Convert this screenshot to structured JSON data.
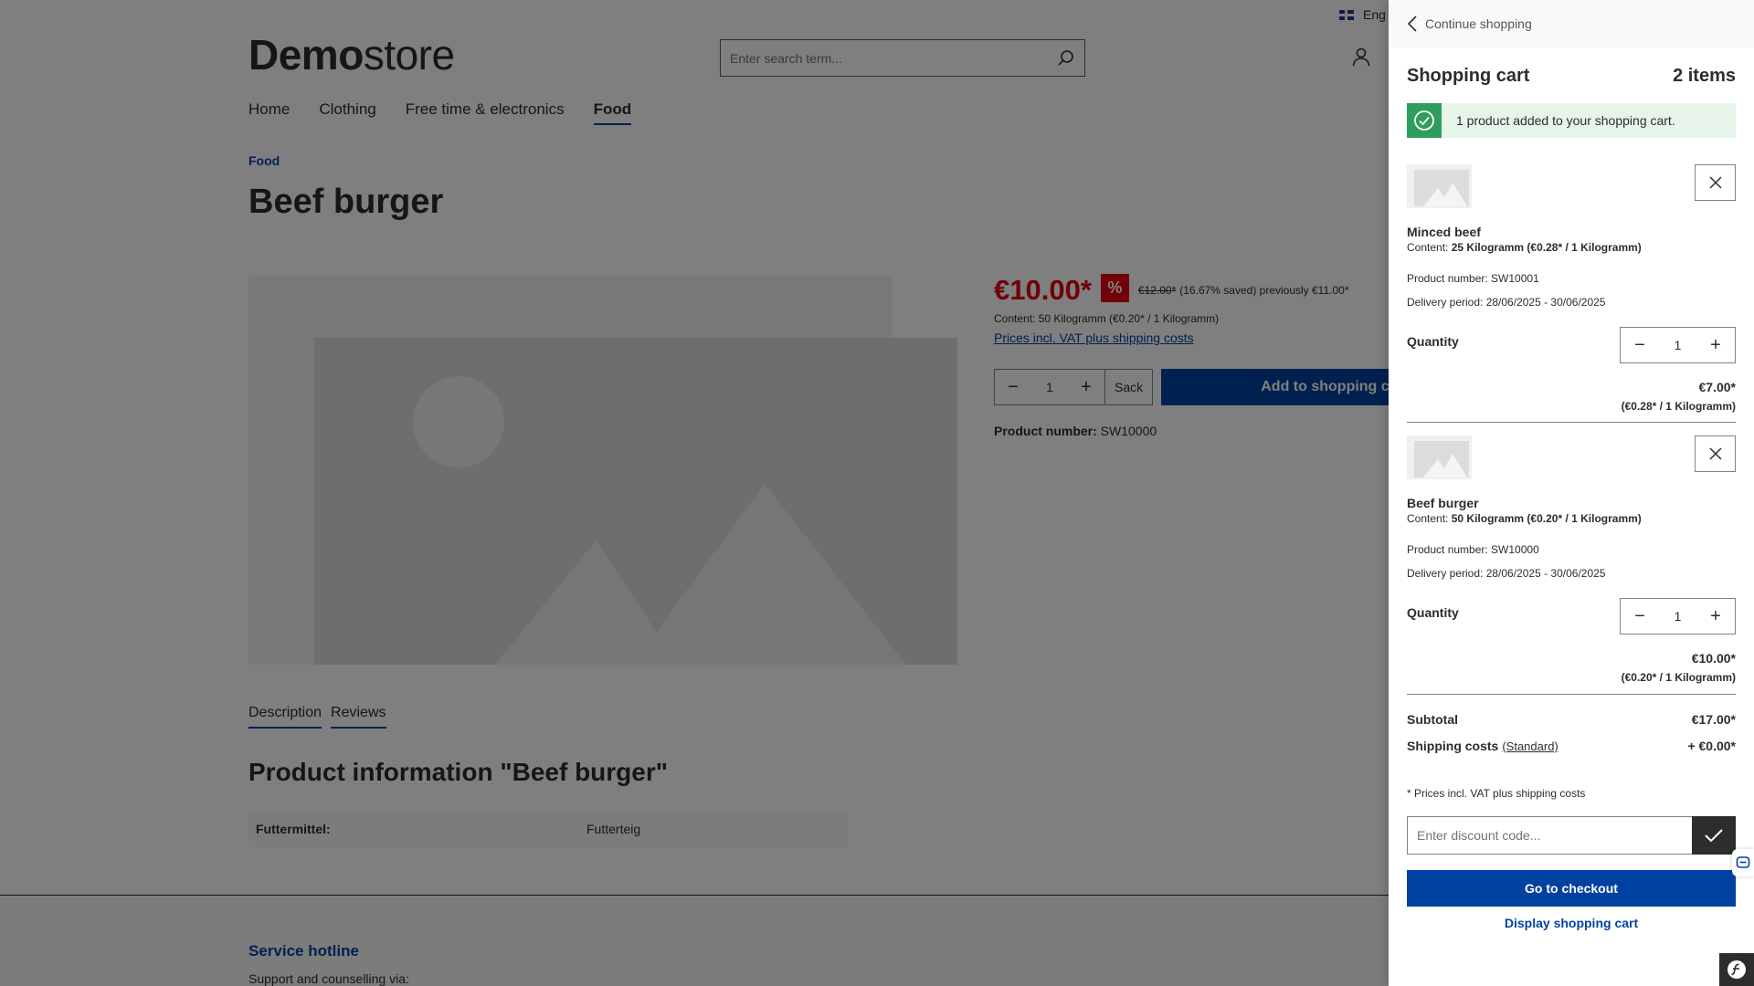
{
  "header": {
    "language": "Eng",
    "logo_bold": "Demo",
    "logo_light": "store",
    "search_placeholder": "Enter search term..."
  },
  "nav": {
    "items": [
      "Home",
      "Clothing",
      "Free time & electronics",
      "Food"
    ],
    "active": "Food"
  },
  "product": {
    "breadcrumb": "Food",
    "title": "Beef burger",
    "price": "€10.00*",
    "discount_badge": "%",
    "list_price": "€12.00*",
    "savings": "(16.67% saved) previously €11.00*",
    "content": "Content: 50 Kilogramm (€0.20* / 1 Kilogramm)",
    "vat_link": "Prices incl. VAT plus shipping costs",
    "quantity": "1",
    "unit": "Sack",
    "add_to_cart": "Add to shopping cart",
    "number_label": "Product number:",
    "number_value": "SW10000",
    "tabs": [
      "Description",
      "Reviews"
    ],
    "info_title": "Product information \"Beef burger\"",
    "property_key": "Futtermittel:",
    "property_value": "Futterteig"
  },
  "footer": {
    "hotline": "Service hotline",
    "support": "Support and counselling via:"
  },
  "cart": {
    "continue": "Continue shopping",
    "title": "Shopping cart",
    "count": "2 items",
    "alert": "1 product added to your shopping cart.",
    "items": [
      {
        "name": "Minced beef",
        "content_label": "Content:",
        "content_value": "25 Kilogramm (€0.28* / 1 Kilogramm)",
        "number": "Product number: SW10001",
        "delivery": "Delivery period: 28/06/2025 - 30/06/2025",
        "qty_label": "Quantity",
        "qty": "1",
        "price": "€7.00*",
        "unit_price": "(€0.28* / 1 Kilogramm)"
      },
      {
        "name": "Beef burger",
        "content_label": "Content:",
        "content_value": "50 Kilogramm (€0.20* / 1 Kilogramm)",
        "number": "Product number: SW10000",
        "delivery": "Delivery period: 28/06/2025 - 30/06/2025",
        "qty_label": "Quantity",
        "qty": "1",
        "price": "€10.00*",
        "unit_price": "(€0.20* / 1 Kilogramm)"
      }
    ],
    "subtotal_label": "Subtotal",
    "subtotal": "€17.00*",
    "shipping_label": "Shipping costs",
    "shipping_method": "(Standard)",
    "shipping": "+ €0.00*",
    "vat_note": "* Prices incl. VAT plus shipping costs",
    "discount_placeholder": "Enter discount code...",
    "checkout": "Go to checkout",
    "display_cart": "Display shopping cart"
  },
  "colors": {
    "brand": "#0042a0",
    "sale": "#e3000f",
    "success": "#2f9d5b"
  }
}
